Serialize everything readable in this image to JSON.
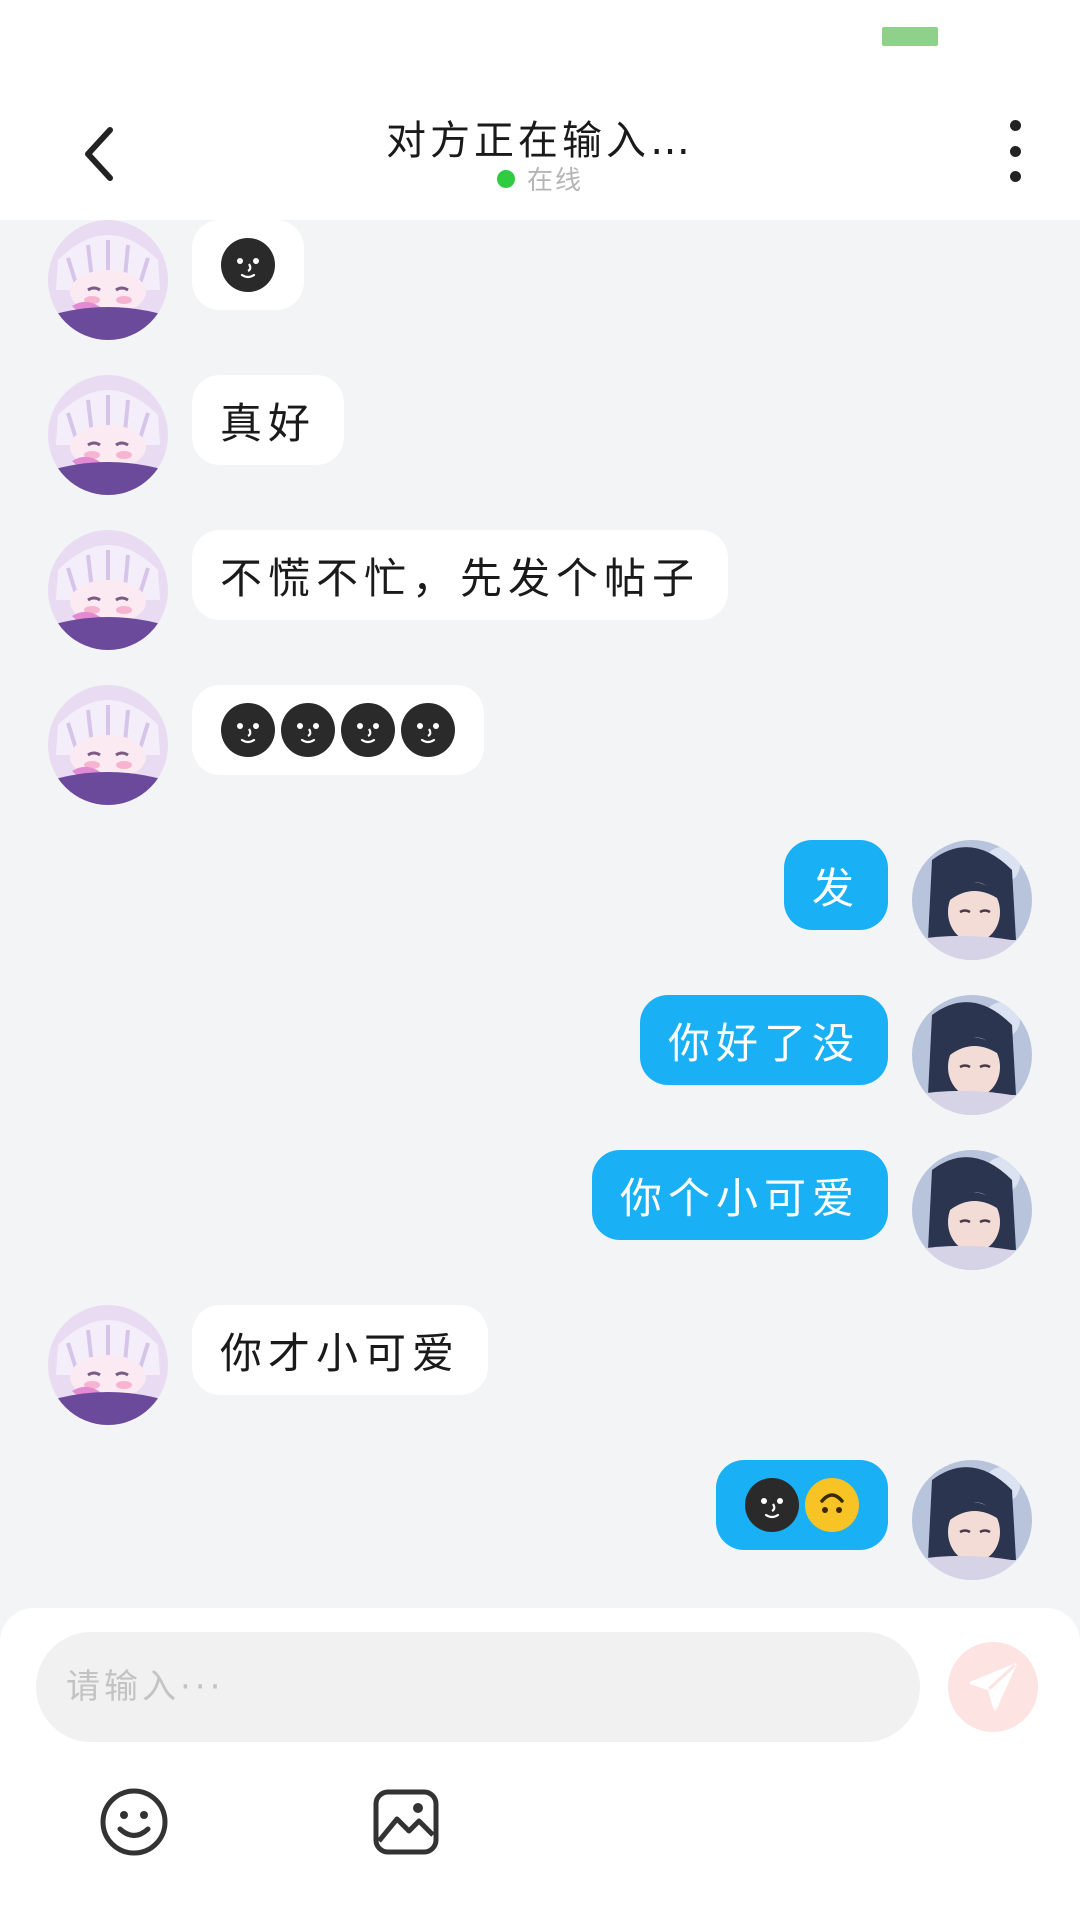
{
  "header": {
    "title": "对方正在输入…",
    "status": "在线"
  },
  "messages": [
    {
      "side": "in",
      "type": "emoji",
      "emojis": [
        "moon-face"
      ]
    },
    {
      "side": "in",
      "type": "text",
      "text": "真好"
    },
    {
      "side": "in",
      "type": "text",
      "text": "不慌不忙，先发个帖子"
    },
    {
      "side": "in",
      "type": "emoji",
      "emojis": [
        "moon-face",
        "moon-face",
        "moon-face",
        "moon-face"
      ]
    },
    {
      "side": "out",
      "type": "text",
      "text": "发"
    },
    {
      "side": "out",
      "type": "text",
      "text": "你好了没"
    },
    {
      "side": "out",
      "type": "text",
      "text": "你个小可爱"
    },
    {
      "side": "in",
      "type": "text",
      "text": "你才小可爱"
    },
    {
      "side": "out",
      "type": "emoji",
      "emojis": [
        "moon-face",
        "upside-down-face"
      ]
    }
  ],
  "composer": {
    "placeholder": "请输入···",
    "value": ""
  },
  "colors": {
    "outgoing_bubble": "#1ab0f5",
    "online": "#2ecc40",
    "send_button": "#fde3e1"
  },
  "icons": {
    "back": "chevron-left-icon",
    "more": "more-vertical-icon",
    "send": "paper-plane-icon",
    "emoji": "smile-icon",
    "image": "image-icon"
  }
}
